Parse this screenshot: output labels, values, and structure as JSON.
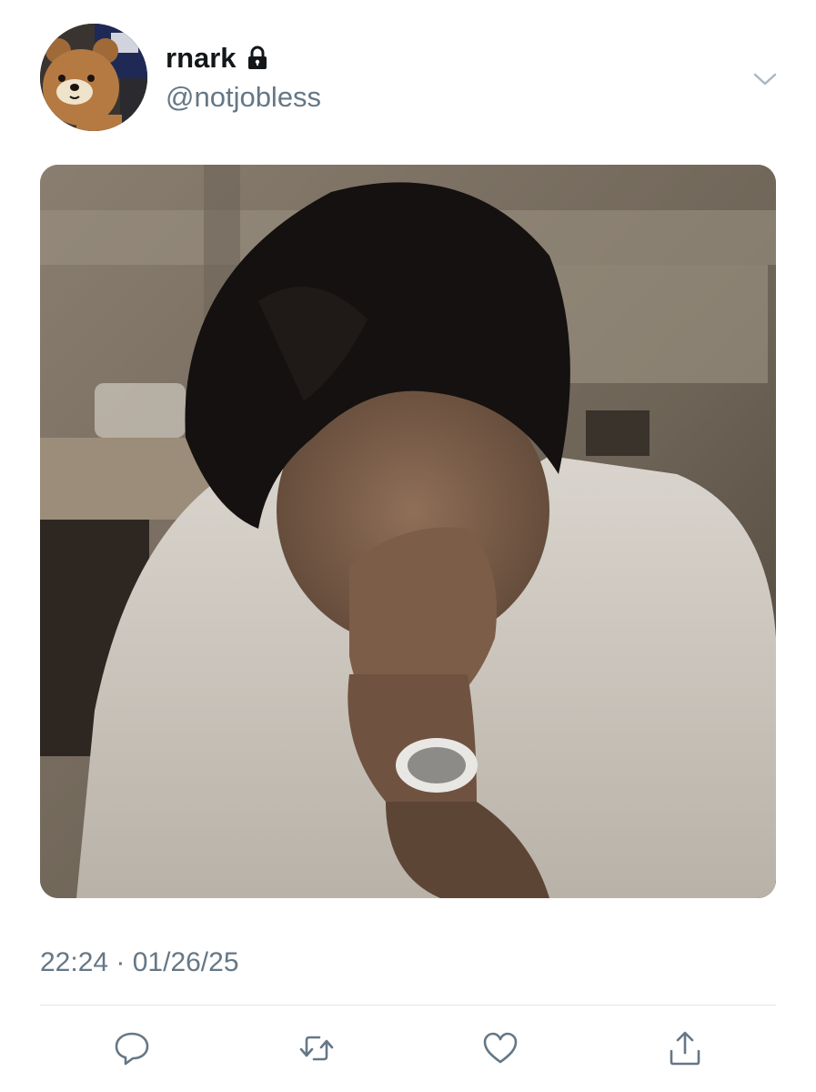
{
  "user": {
    "display_name": "rnark",
    "protected_icon": "lock-icon",
    "handle": "@notjobless",
    "avatar_icon": "teddy-bear-avatar"
  },
  "menu": {
    "icon": "chevron-down-icon"
  },
  "tweet": {
    "media_description_icon": "photo",
    "timestamp": "22:24 · 01/26/25"
  },
  "actions": [
    {
      "name": "reply",
      "icon": "speech-bubble-icon"
    },
    {
      "name": "retweet",
      "icon": "retweet-icon"
    },
    {
      "name": "like",
      "icon": "heart-icon"
    },
    {
      "name": "share",
      "icon": "share-icon"
    }
  ],
  "colors": {
    "text_primary": "#14171a",
    "text_secondary": "#657786",
    "icon": "#657786",
    "divider": "#e1e8ed"
  }
}
